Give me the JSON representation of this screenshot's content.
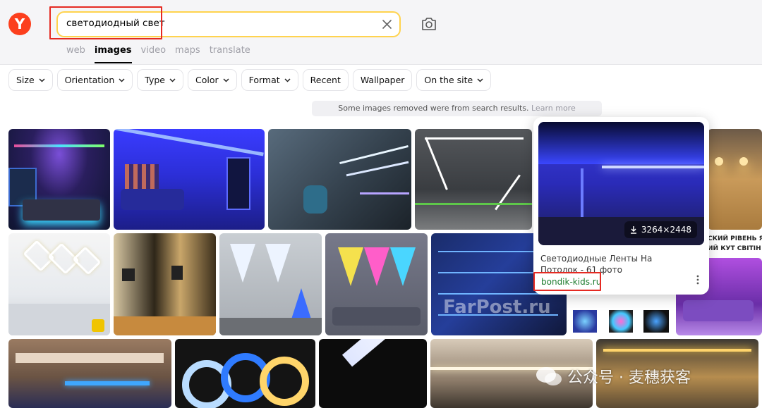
{
  "search": {
    "query": "светодиодный свет"
  },
  "tabs": [
    {
      "label": "web",
      "active": false
    },
    {
      "label": "images",
      "active": true
    },
    {
      "label": "video",
      "active": false
    },
    {
      "label": "maps",
      "active": false
    },
    {
      "label": "translate",
      "active": false
    }
  ],
  "filters": {
    "size": "Size",
    "orientation": "Orientation",
    "type": "Type",
    "color": "Color",
    "format": "Format",
    "recent": "Recent",
    "wallpaper": "Wallpaper",
    "on_the_site": "On the site"
  },
  "notice": {
    "text": "Some images removed were from search results.",
    "link": "Learn more"
  },
  "popup": {
    "size": "3264×2448",
    "title": "Светодиодные Ленты На Потолок - 61 фото",
    "source": "bondik-kids.ru"
  },
  "image_overlays": {
    "farpost": "FarPost.ru",
    "side_text_line1": "СКИЙ РІВЕНЬ ЯС",
    "side_text_line2": "ИЙ КУТ СВІТІН"
  },
  "watermark": {
    "text": "公众号 · 麦穗获客"
  },
  "colors": {
    "brand": "#fc3f1d",
    "search_border": "#ffd34e",
    "highlight_box": "#e52a22",
    "source_link": "#1a7a2c"
  }
}
